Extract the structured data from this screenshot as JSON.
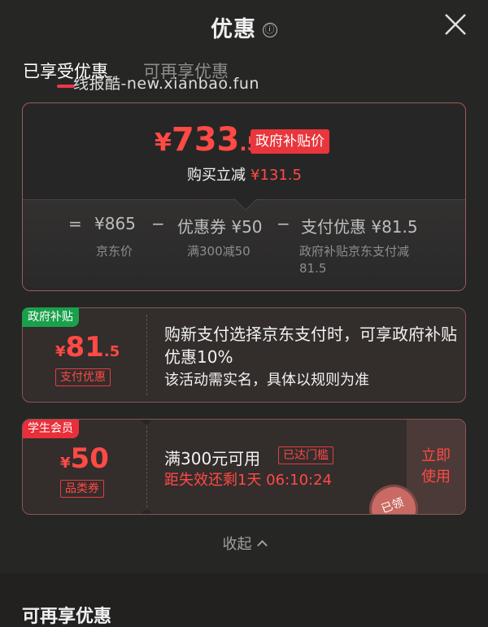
{
  "header": {
    "title": "优惠",
    "info_icon": "ⓘ",
    "close_icon": "close-icon"
  },
  "tabs": [
    {
      "label": "已享受优惠",
      "active": true
    },
    {
      "label": "可再享优惠",
      "active": false
    }
  ],
  "watermark": "线报酷-new.xianbao.fun",
  "summary": {
    "final_price_yen": "¥",
    "final_price_int": "733",
    "final_price_dec": ".5",
    "gov_tag": "政府补贴价",
    "reduce_label": "购买立减",
    "reduce_amount": "¥131.5",
    "eq_sign": "=",
    "jd_price": "¥865",
    "minus": "−",
    "coupon_label": "优惠券 ¥50",
    "pay_label": "支付优惠 ¥81.5",
    "jd_sub": "京东价",
    "coupon_sub": "满300减50",
    "pay_sub": "政府补贴京东支付减81.5"
  },
  "coupons": [
    {
      "badge": "政府补贴",
      "yen": "¥",
      "amount_int": "81",
      "amount_dec": ".5",
      "type": "支付优惠",
      "desc": "购新支付选择京东支付时，可享政府补贴优惠10%",
      "desc2": "该活动需实名，具体以规则为准"
    },
    {
      "badge": "学生会员",
      "yen": "¥",
      "amount_int": "50",
      "type": "品类券",
      "condition": "满300元可用",
      "reached": "已达门槛",
      "countdown": "距失效还剩1天 06:10:24",
      "use_button": "立即使用",
      "stamp": "已领"
    }
  ],
  "collapse_label": "收起",
  "section_title": "可再享优惠",
  "colors": {
    "accent": "#ff4a45",
    "green_badge": "#1aa04a",
    "background": "#262625"
  }
}
